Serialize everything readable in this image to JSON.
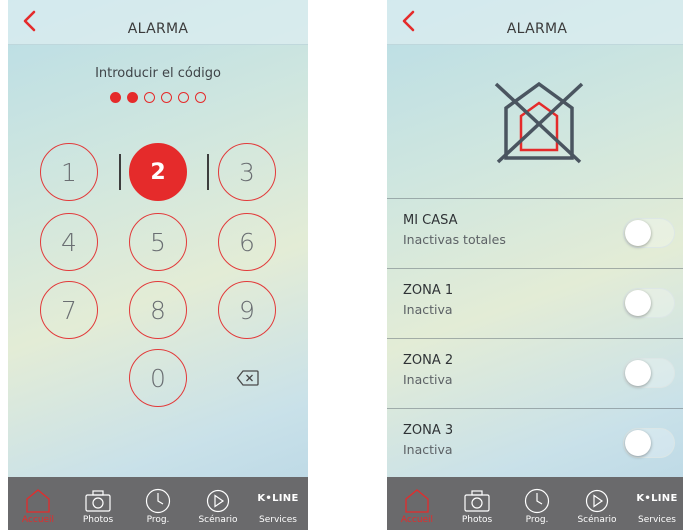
{
  "colors": {
    "accent": "#e52b2b",
    "tabbar": "#6a6a6c",
    "text_dark": "#3b3b3b"
  },
  "left_screen": {
    "title": "ALARMA",
    "prompt": "Introducir el código",
    "code_dots": {
      "total": 6,
      "filled": 2
    },
    "keys": [
      "1",
      "2",
      "3",
      "4",
      "5",
      "6",
      "7",
      "8",
      "9",
      "0"
    ],
    "active_key": "2",
    "backspace_icon": "backspace-icon"
  },
  "right_screen": {
    "title": "ALARMA",
    "house_icon": "house-disarmed-icon",
    "zones": [
      {
        "name": "MI CASA",
        "status": "Inactivas totales",
        "enabled": false
      },
      {
        "name": "ZONA 1",
        "status": "Inactiva",
        "enabled": false
      },
      {
        "name": "ZONA 2",
        "status": "Inactiva",
        "enabled": false
      },
      {
        "name": "ZONA 3",
        "status": "Inactiva",
        "enabled": false
      }
    ]
  },
  "tabbar": {
    "tabs": [
      {
        "label": "Accueil",
        "icon": "home-icon",
        "active": true
      },
      {
        "label": "Photos",
        "icon": "camera-icon",
        "active": false
      },
      {
        "label": "Prog.",
        "icon": "clock-icon",
        "active": false
      },
      {
        "label": "Scénario",
        "icon": "play-icon",
        "active": false
      },
      {
        "label": "Services",
        "icon": "kline-logo",
        "brand": "K•LINE",
        "active": false
      }
    ]
  }
}
